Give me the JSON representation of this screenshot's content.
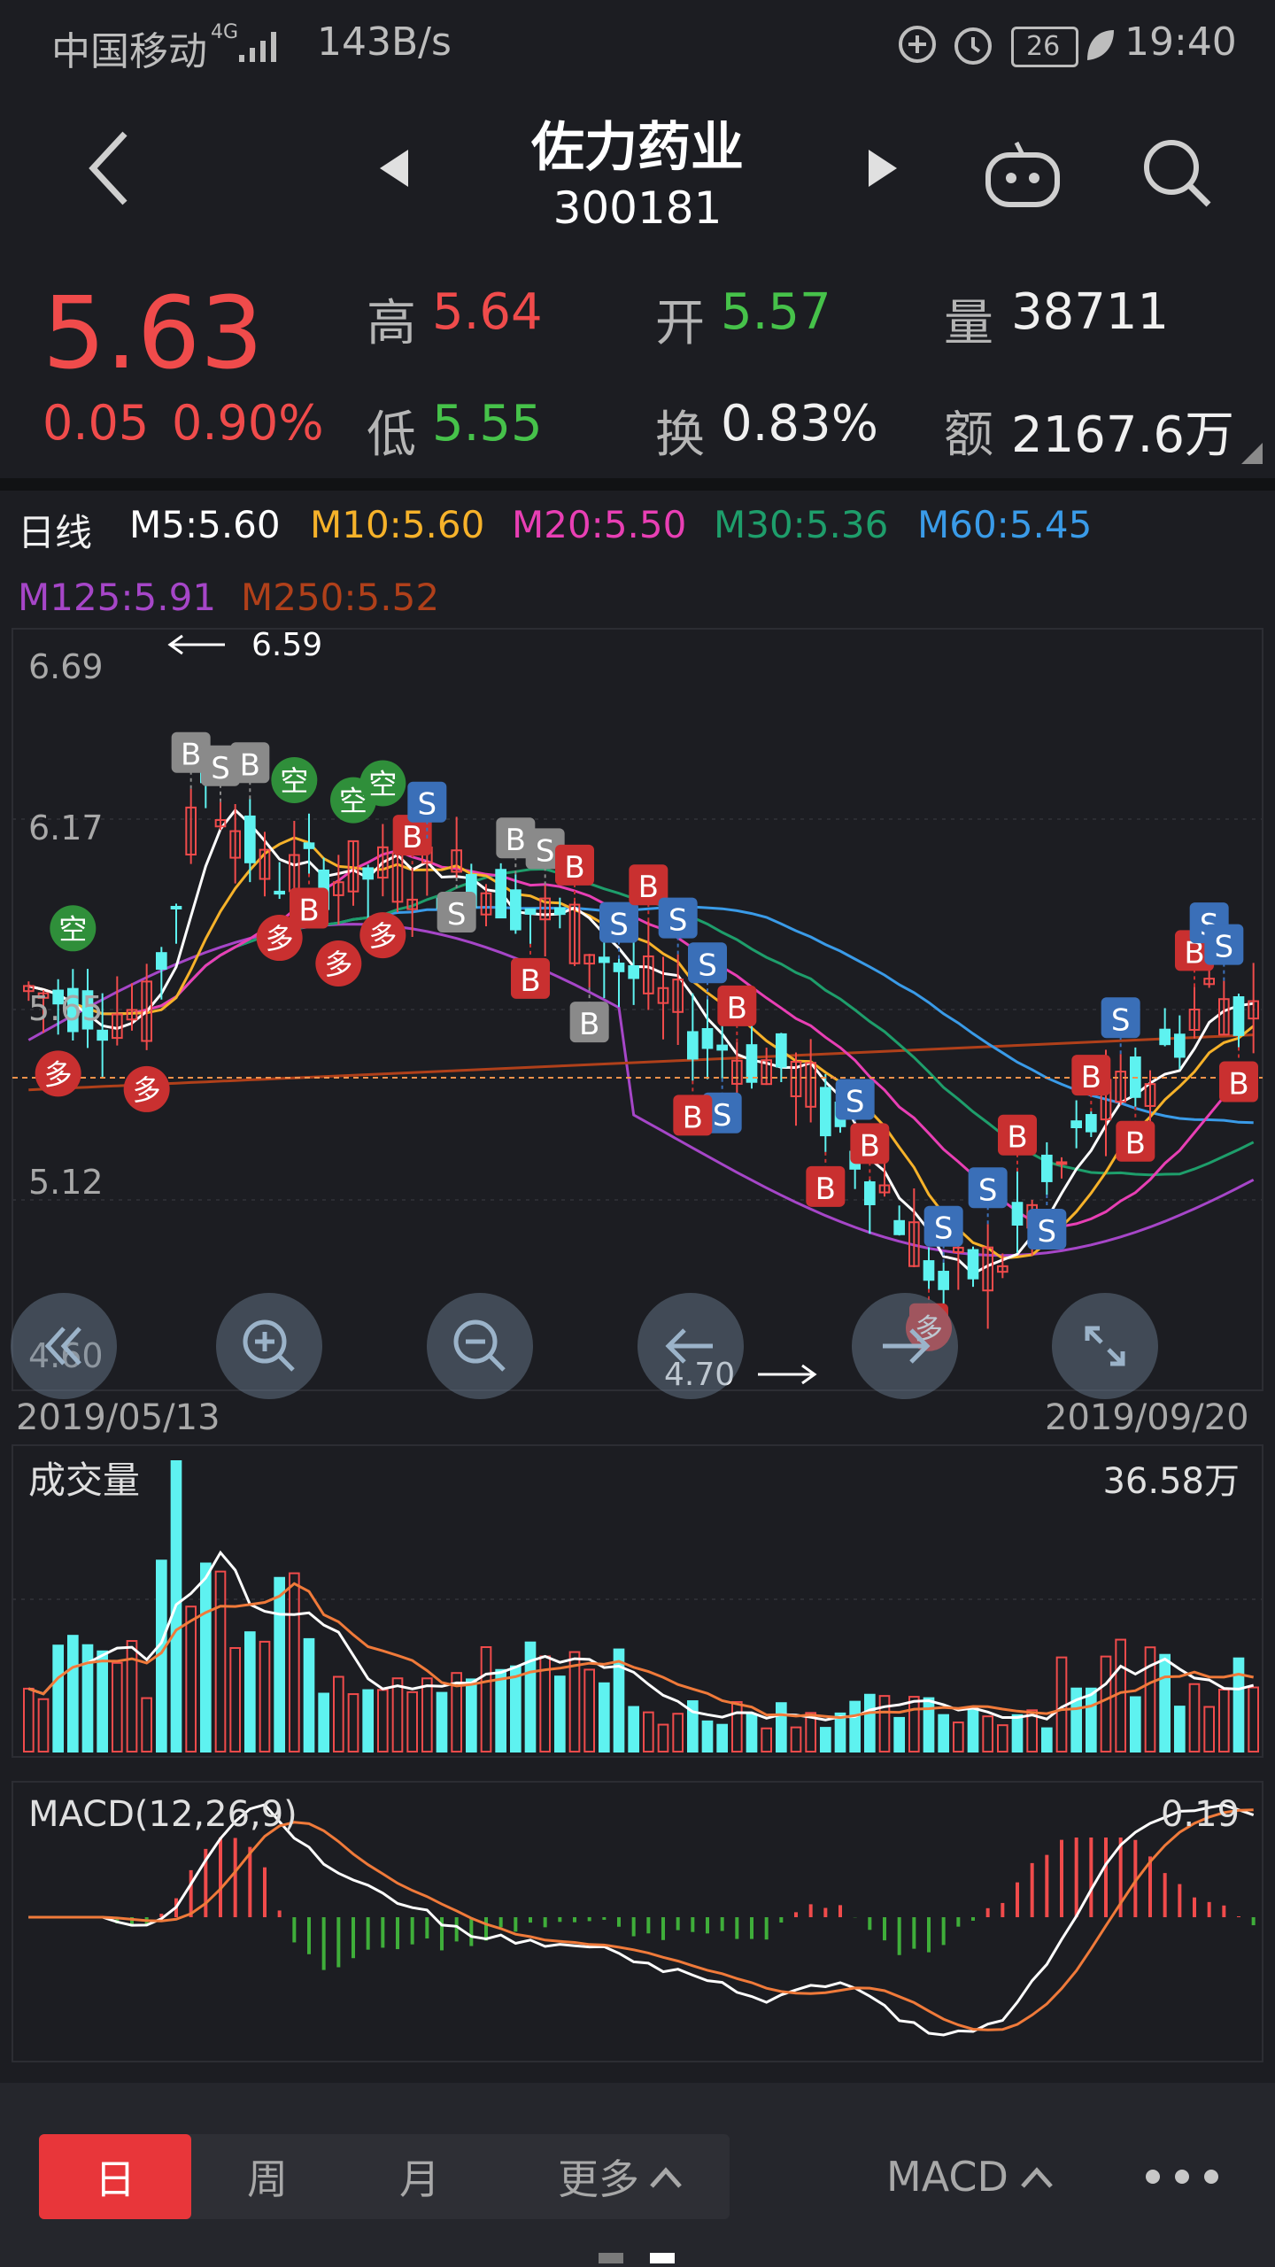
{
  "status_bar": {
    "carrier": "中国移动",
    "network": "4G",
    "speed": "143B/s",
    "battery": "26",
    "time": "19:40"
  },
  "header": {
    "stock_name": "佐力药业",
    "stock_code": "300181"
  },
  "quote": {
    "price": "5.63",
    "change": "0.05",
    "change_pct": "0.90%",
    "high_label": "高",
    "high": "5.64",
    "low_label": "低",
    "low": "5.55",
    "open_label": "开",
    "open": "5.57",
    "turnover_label": "换",
    "turnover": "0.83%",
    "volume_label": "量",
    "volume": "38711",
    "amount_label": "额",
    "amount": "2167.6万"
  },
  "ma_legend": {
    "period": "日线",
    "m5": "M5:5.60",
    "m10": "M10:5.60",
    "m20": "M20:5.50",
    "m30": "M30:5.36",
    "m60": "M60:5.45",
    "m125": "M125:5.91",
    "m250": "M250:5.52"
  },
  "colors": {
    "up": "#f04b4b",
    "down": "#5ef2f0",
    "m5": "#ffffff",
    "m10": "#f6b22a",
    "m20": "#e83fb4",
    "m30": "#1e9e6b",
    "m60": "#3a9be8",
    "m125": "#a646c8",
    "m250": "#b0401a"
  },
  "chart_data": [
    {
      "type": "candlestick",
      "title": "日线",
      "y_ticks": [
        "6.69",
        "6.17",
        "5.65",
        "5.12",
        "4.60"
      ],
      "ylim": [
        4.6,
        6.69
      ],
      "x_range": [
        "2019/05/13",
        "2019/09/20"
      ],
      "annotations": [
        {
          "label": "6.59",
          "kind": "max-arrow"
        },
        {
          "label": "4.70",
          "kind": "min-arrow"
        }
      ],
      "current_price_line": 5.63
    },
    {
      "type": "bar",
      "title": "成交量",
      "max_label": "36.58万"
    },
    {
      "type": "bar",
      "title": "MACD(12,26,9)",
      "max_label": "0.19"
    }
  ],
  "signal_markers": {
    "buy": "B",
    "sell": "S",
    "long": "多",
    "short": "空"
  },
  "bottom_bar": {
    "day": "日",
    "week": "周",
    "month": "月",
    "more": "更多",
    "indicator": "MACD"
  }
}
